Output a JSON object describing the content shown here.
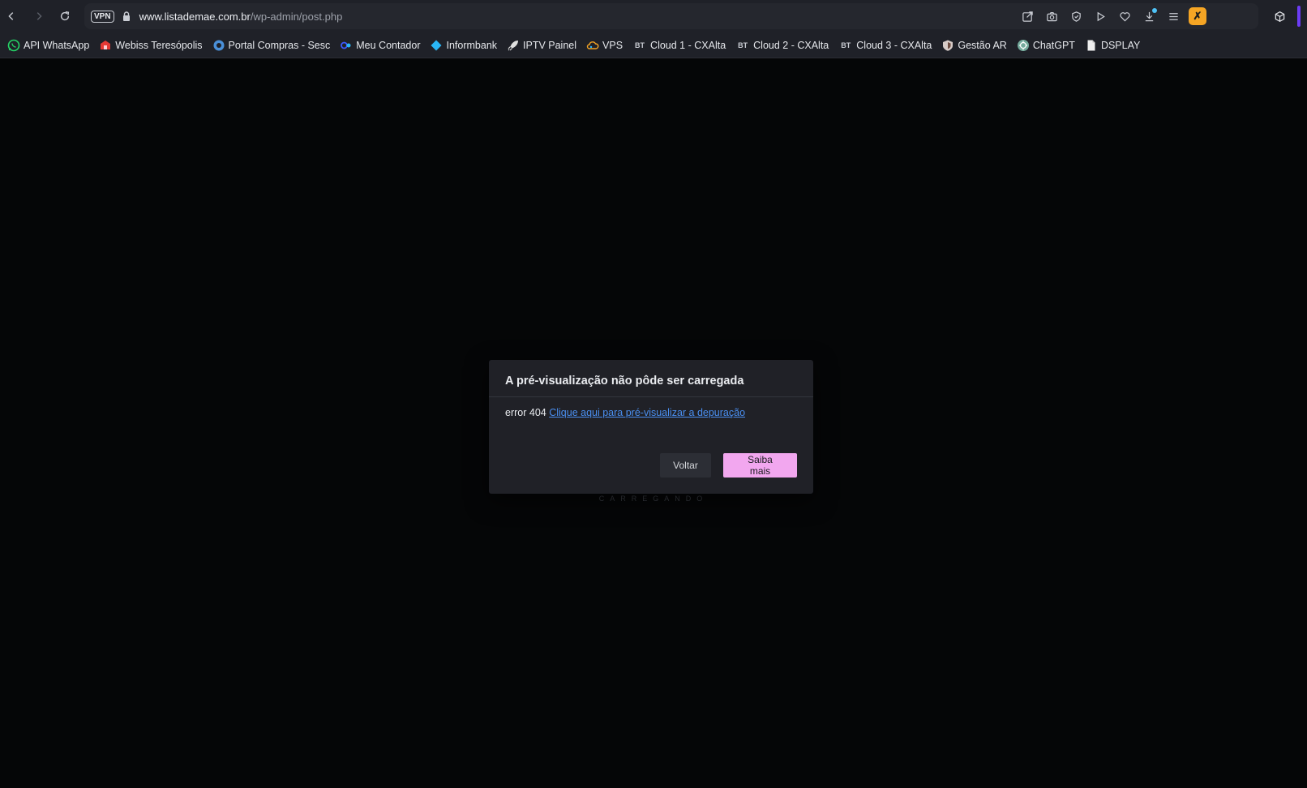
{
  "browser": {
    "vpn_label": "VPN",
    "url_host": "www.listademae.com.br",
    "url_path": "/wp-admin/post.php"
  },
  "bookmarks": [
    {
      "label": "API WhatsApp",
      "icon": "whatsapp-icon",
      "color": "#25d366"
    },
    {
      "label": "Webiss Teresópolis",
      "icon": "webiss-icon",
      "color": "#e53935"
    },
    {
      "label": "Portal Compras - Sesc",
      "icon": "portal-icon",
      "color": "#4a90d9"
    },
    {
      "label": "Meu Contador",
      "icon": "contador-icon",
      "color": "#3d5afe"
    },
    {
      "label": "Informbank",
      "icon": "informbank-icon",
      "color": "#29b6f6"
    },
    {
      "label": "IPTV Painel",
      "icon": "rocket-icon",
      "color": "#e0e0e0"
    },
    {
      "label": "VPS",
      "icon": "cloud-icon",
      "color": "#f5a524"
    },
    {
      "label": "Cloud 1 - CXAlta",
      "icon": "bt-icon",
      "icon_text": "BT"
    },
    {
      "label": "Cloud 2 - CXAlta",
      "icon": "bt-icon",
      "icon_text": "BT"
    },
    {
      "label": "Cloud 3 - CXAlta",
      "icon": "bt-icon",
      "icon_text": "BT"
    },
    {
      "label": "Gestão AR",
      "icon": "shield-icon",
      "color": "#d7ccc8"
    },
    {
      "label": "ChatGPT",
      "icon": "chatgpt-icon",
      "color": "#74aa9c"
    },
    {
      "label": "DSPLAY",
      "icon": "document-icon",
      "color": "#eeeeee"
    }
  ],
  "modal": {
    "title": "A pré-visualização não pôde ser carregada",
    "error_text": "error 404",
    "link_text": "Clique aqui para pré-visualizar a depuração",
    "back_label": "Voltar",
    "more_label": "Saiba mais"
  },
  "loading_text": "CARREGANDO",
  "colors": {
    "primary_button": "#f2a7ef",
    "link": "#4a8ff0",
    "accent": "#6c3cf5"
  }
}
